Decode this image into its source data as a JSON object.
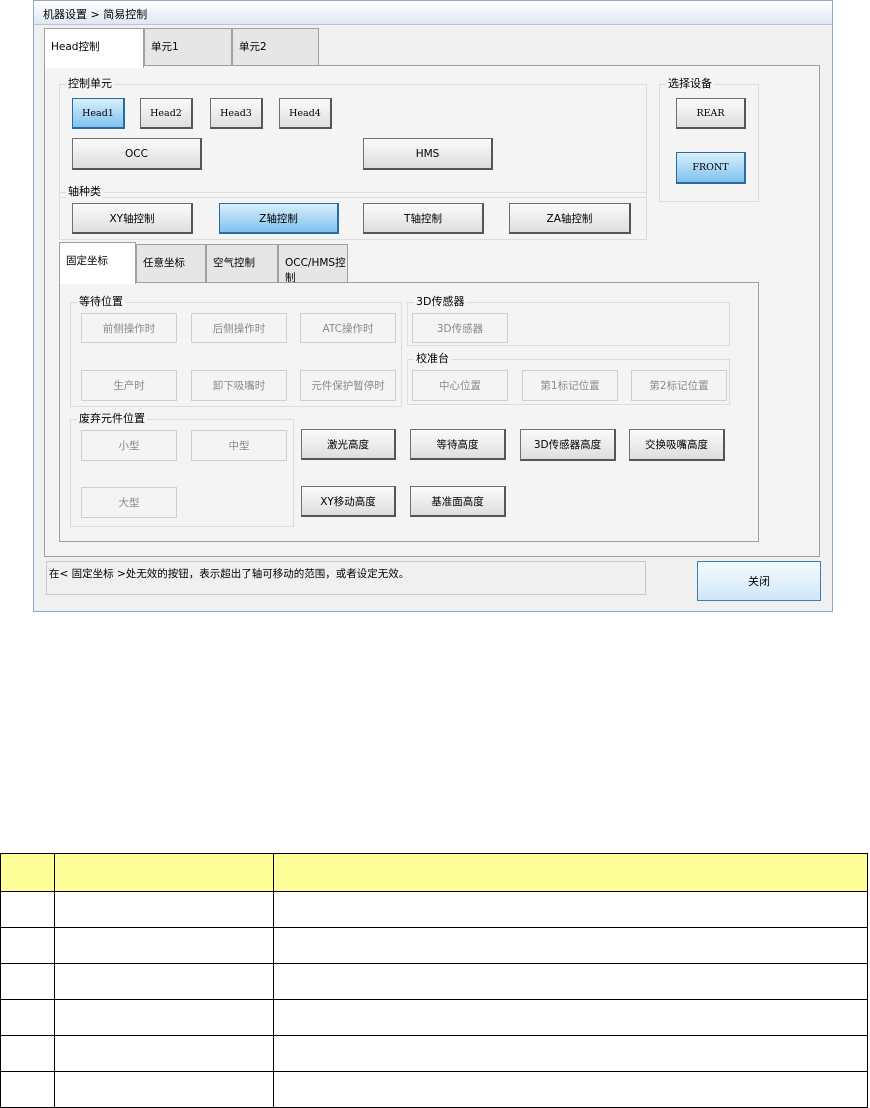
{
  "window": {
    "title": "机器设置 > 简易控制",
    "tabs": [
      "Head控制",
      "单元1",
      "单元2"
    ],
    "control_unit": {
      "label": "控制单元",
      "heads": [
        "Head1",
        "Head2",
        "Head3",
        "Head4"
      ],
      "occ": "OCC",
      "hms": "HMS"
    },
    "axis": {
      "label": "轴种类",
      "buttons": [
        "XY轴控制",
        "Z轴控制",
        "T轴控制",
        "ZA轴控制"
      ]
    },
    "device": {
      "label": "选择设备",
      "rear": "REAR",
      "front": "FRONT"
    },
    "subtabs": [
      "固定坐标",
      "任意坐标",
      "空气控制",
      "OCC/HMS控制"
    ],
    "wait_position": {
      "label": "等待位置",
      "buttons": [
        "前侧操作时",
        "后侧操作时",
        "ATC操作时",
        "生产时",
        "卸下吸嘴时",
        "元件保护暂停时"
      ]
    },
    "sensor3d": {
      "label": "3D传感器",
      "button": "3D传感器"
    },
    "calibration": {
      "label": "校准台",
      "buttons": [
        "中心位置",
        "第1标记位置",
        "第2标记位置"
      ]
    },
    "discard": {
      "label": "废弃元件位置",
      "small": "小型",
      "medium": "中型",
      "large": "大型"
    },
    "heights": {
      "laser": "激光高度",
      "wait": "等待高度",
      "sensor": "3D传感器高度",
      "nozzle": "交换吸嘴高度",
      "xy": "XY移动高度",
      "base": "基准面高度"
    },
    "status": "在< 固定坐标 >处无效的按钮，表示超出了轴可移动的范围，或者设定无效。",
    "close": "关闭"
  },
  "doc_table": {
    "rows": 6
  }
}
